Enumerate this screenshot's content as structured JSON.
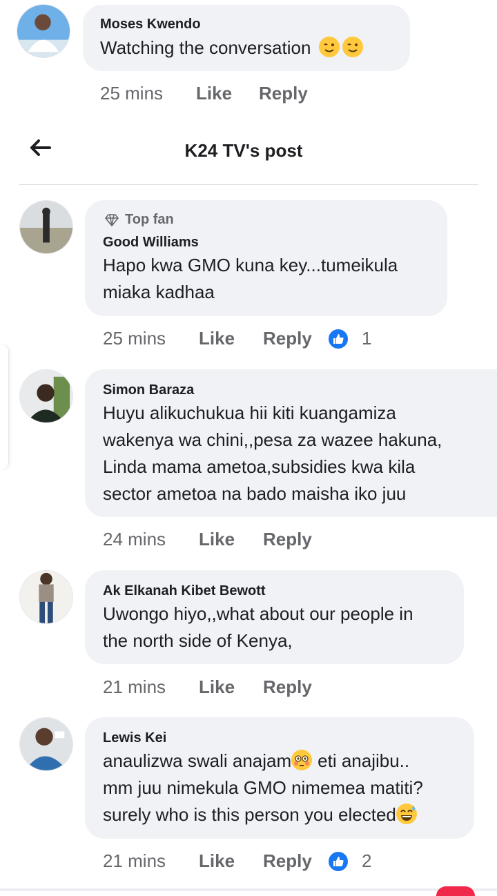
{
  "header": {
    "title": "K24 TV's post"
  },
  "top_comment": {
    "author": "Moses Kwendo",
    "text": "Watching the conversation",
    "emojis": [
      "winking-face",
      "winking-face"
    ],
    "time": "25 mins",
    "like": "Like",
    "reply": "Reply"
  },
  "comments": [
    {
      "badge": "Top fan",
      "author": "Good Williams",
      "lines": [
        "Hapo kwa GMO kuna key...tumeikula",
        "miaka kadhaa"
      ],
      "time": "25 mins",
      "like": "Like",
      "reply": "Reply",
      "reactions": "1"
    },
    {
      "author": "Simon Baraza",
      "lines": [
        "Huyu alikuchukua hii kiti kuangamiza",
        "wakenya wa chini,,pesa za wazee hakuna,",
        "Linda mama ametoa,subsidies kwa kila",
        "sector ametoa na bado maisha iko juu"
      ],
      "time": "24 mins",
      "like": "Like",
      "reply": "Reply"
    },
    {
      "author": "Ak Elkanah Kibet Bewott",
      "lines": [
        "Uwongo hiyo,,what about our people in",
        "the north side of Kenya,"
      ],
      "time": "21 mins",
      "like": "Like",
      "reply": "Reply"
    },
    {
      "author": "Lewis Kei",
      "lines": [
        "anaulizwa swali anajam",
        "eti anajibu..",
        "mm juu nimekula GMO nimemea matiti?",
        "surely who is this person you elected"
      ],
      "time": "21 mins",
      "like": "Like",
      "reply": "Reply",
      "reactions": "2"
    }
  ],
  "colors": {
    "bubble": "#f0f2f5",
    "meta": "#65676b",
    "like_blue": "#1877f2",
    "emoji": "#ffc83d"
  }
}
